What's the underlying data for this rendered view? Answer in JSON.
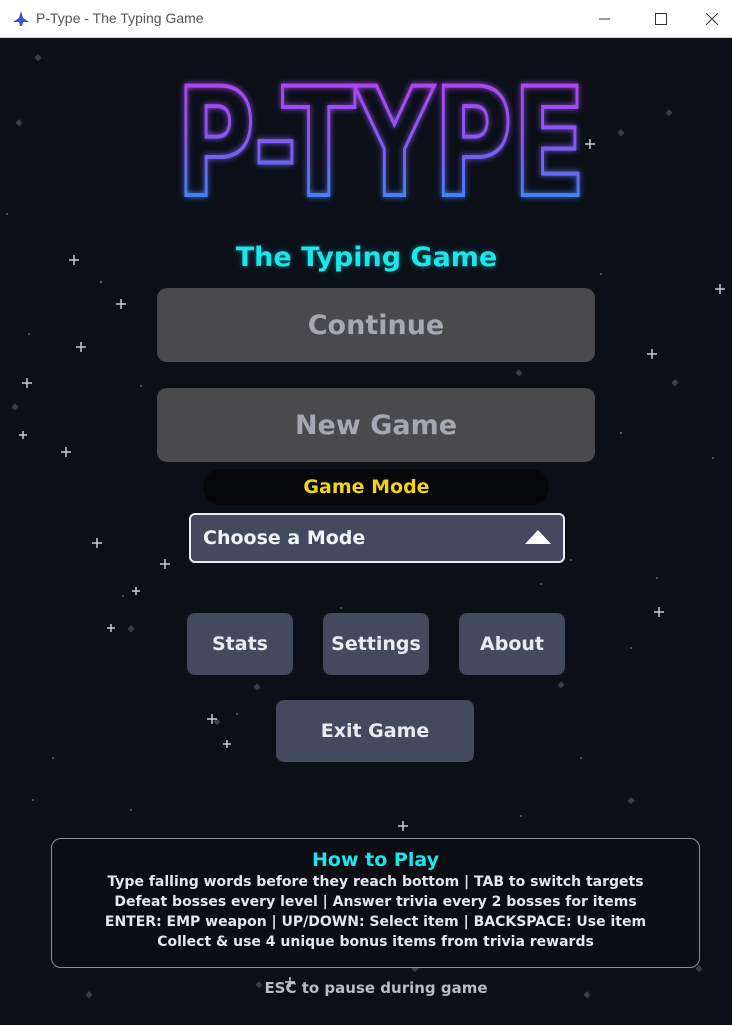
{
  "window": {
    "title": "P-Type - The Typing Game",
    "icons": {
      "app": "spaceship-icon",
      "minimize": "minimize-icon",
      "maximize": "maximize-icon",
      "close": "close-icon"
    }
  },
  "logo": {
    "text": "P-TYPE"
  },
  "subtitle": "The Typing Game",
  "menu": {
    "continue_label": "Continue",
    "new_game_label": "New Game",
    "game_mode_label": "Game Mode",
    "mode_select_value": "Choose a Mode",
    "stats_label": "Stats",
    "settings_label": "Settings",
    "about_label": "About",
    "exit_label": "Exit Game"
  },
  "how_to_play": {
    "title": "How to Play",
    "lines": [
      "Type falling words before they reach bottom | TAB to switch targets",
      "Defeat bosses every level | Answer trivia every 2 bosses for items",
      "ENTER: EMP weapon | UP/DOWN: Select item | BACKSPACE: Use item",
      "Collect & use 4 unique bonus items from trivia rewards"
    ]
  },
  "footer_hint": "ESC to pause during game",
  "colors": {
    "background": "#0b0f18",
    "accent_cyan": "#19e7ee",
    "accent_yellow": "#f2d21a",
    "logo_top": "#c23cf0",
    "logo_bottom": "#1a9cf5",
    "button_disabled": "#4a4a4c",
    "button": "#444a5e"
  }
}
